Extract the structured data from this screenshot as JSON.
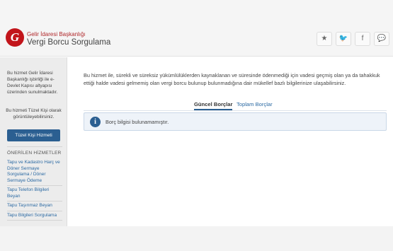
{
  "header": {
    "logo_letter": "G",
    "org_name": "Gelir İdaresi Başkanlığı",
    "title": "Vergi Borcu Sorgulama",
    "social": [
      {
        "icon": "star-icon",
        "glyph": "★"
      },
      {
        "icon": "twitter-icon",
        "glyph": "🐦"
      },
      {
        "icon": "facebook-icon",
        "glyph": "f"
      },
      {
        "icon": "chat-icon",
        "glyph": "💬"
      }
    ]
  },
  "sidebar": {
    "info_text": "Bu hizmet Gelir İdaresi Başkanlığı işbirliği ile e-Devlet Kapısı altyapısı üzerinden sunulmaktadır.",
    "corporate_text": "Bu hizmeti Tüzel Kişi olarak görüntüleyebilirsiniz.",
    "corporate_button": "Tüzel Kişi Hizmeti",
    "recommended_heading": "ÖNERİLEN HİZMETLER",
    "recommended": [
      "Tapu ve Kadastro Harç ve Döner Sermaye Sorgulama / Döner Sermaye Ödeme",
      "Tapu Telefon Bilgileri Beyan",
      "Tapu Taşınmaz Beyan",
      "Tapu Bilgileri Sorgulama"
    ]
  },
  "main": {
    "description": "Bu hizmet ile, sürekli ve süreksiz yükümlülüklerden kaynaklanan ve süresinde ödenmediği için vadesi geçmiş olan ya da tahakkuk ettiği halde vadesi gelmemiş olan vergi borcu bulunup bulunmadığına dair mükellef bazlı bilgilerinize ulaşabilirsiniz.",
    "tabs": [
      {
        "label": "Güncel Borçlar",
        "active": true
      },
      {
        "label": "Toplam Borçlar",
        "active": false
      }
    ],
    "alert": {
      "icon": "i",
      "text": "Borç bilgisi bulunamamıştır."
    }
  },
  "colors": {
    "brand_red": "#c2151b",
    "primary_blue": "#2b5f91",
    "link_blue": "#2c6aa3"
  }
}
